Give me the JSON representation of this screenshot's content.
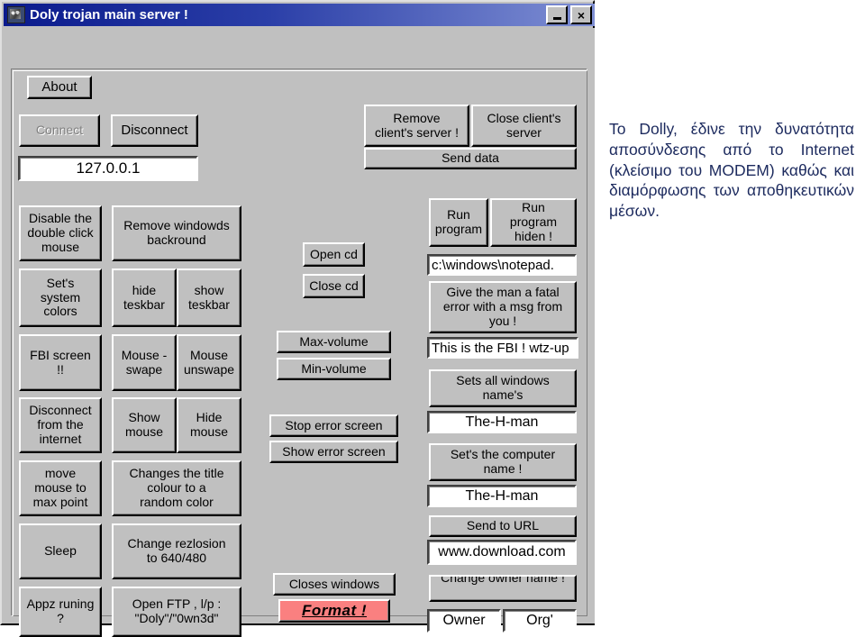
{
  "window": {
    "title": "Doly trojan main server !",
    "icon": "trojan-horse-icon",
    "minimize_label": "_",
    "close_label": "×",
    "background_color": "#c0c0c0",
    "titlebar_color": "#0a1a8c"
  },
  "tab": {
    "about_label": "About"
  },
  "connection": {
    "connect_label": "Connect",
    "connect_disabled": true,
    "disconnect_label": "Disconnect",
    "host_value": "127.0.0.1"
  },
  "server_controls": {
    "remove_label": "Remove\nclient's server !",
    "close_label": "Close client's\nserver",
    "send_data_label": "Send data"
  },
  "left_column": [
    {
      "label": "Disable the\ndouble click\nmouse"
    },
    {
      "label": "Set's\nsystem\ncolors"
    },
    {
      "label": "FBI screen\n!!"
    },
    {
      "label": "Disconnect\nfrom the\ninternet"
    },
    {
      "label": "move\nmouse to\nmax point"
    },
    {
      "label": "Sleep"
    },
    {
      "label": "Appz runing\n?"
    }
  ],
  "second_column": [
    {
      "type": "single",
      "label": "Remove windowds\nbackround"
    },
    {
      "type": "pair",
      "left": "hide\nteskbar",
      "right": "show\nteskbar"
    },
    {
      "type": "pair",
      "left": "Mouse -\nswape",
      "right": "Mouse\nunswape"
    },
    {
      "type": "pair",
      "left": "Show\nmouse",
      "right": "Hide\nmouse"
    },
    {
      "type": "single",
      "label": "Changes the title\ncolour to a\nrandom color"
    },
    {
      "type": "single",
      "label": "Change rezlosion\nto  640/480"
    },
    {
      "type": "single",
      "label": "Open FTP , l/p :\n\"Doly\"/\"0wn3d\""
    }
  ],
  "middle_column": {
    "open_cd": "Open cd",
    "close_cd": "Close cd",
    "max_volume": "Max-volume",
    "min_volume": "Min-volume",
    "stop_error_screen": "Stop error screen",
    "show_error_screen": "Show error screen",
    "closes_windows": "Closes windows",
    "format": "Format !",
    "format_color": "#fa8080"
  },
  "right_column": {
    "run_program": "Run\nprogram",
    "run_program_hidden": "Run\nprogram\nhiden !",
    "run_path_value": "c:\\windows\\notepad.",
    "fatal_error_label": "Give the man a fatal\nerror with a msg from\nyou !",
    "fatal_error_value": "This is the FBI ! wtz-up",
    "sets_all_windows_names_label": "Sets all windows\nname's",
    "sets_all_windows_names_value": "The-H-man",
    "set_computer_name_label": "Set's the computer\nname !",
    "set_computer_name_value": "The-H-man",
    "send_to_url_label": "Send to URL",
    "send_to_url_value": "www.download.com",
    "change_owner_name_label": "Change owner name !",
    "owner_value": "Owner",
    "org_value": "Org'"
  },
  "caption": {
    "text": "Το Dolly, έδινε την δυνατότητα αποσύνδεσης από το Internet (κλείσιμο του MODEM) καθώς και διαμόρφωσης των αποθηκευτικών μέσων.",
    "color": "#1c2a5e"
  }
}
